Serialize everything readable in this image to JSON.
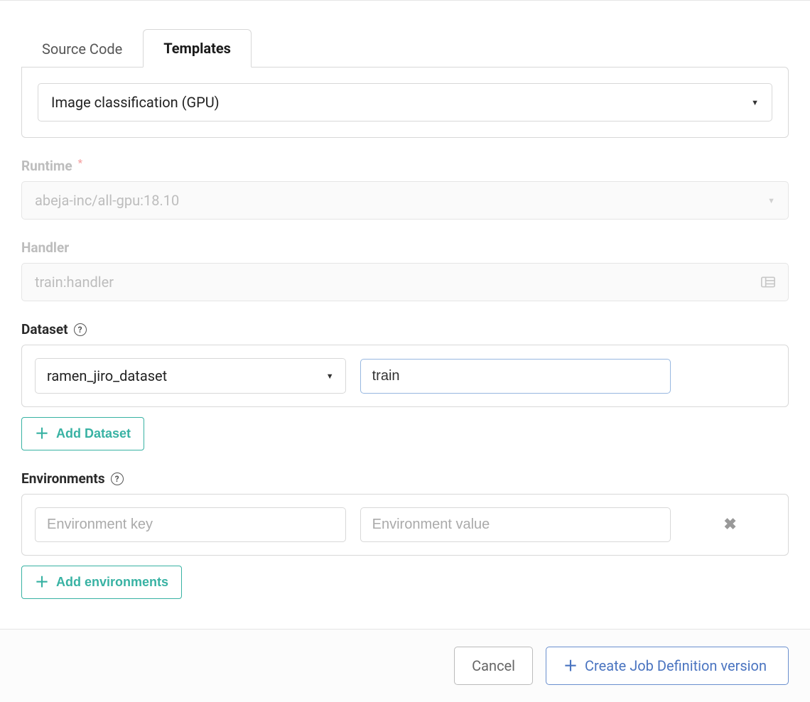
{
  "tabs": {
    "source_code": "Source Code",
    "templates": "Templates"
  },
  "template": {
    "selected": "Image classification (GPU)"
  },
  "runtime": {
    "label": "Runtime",
    "value": "abeja-inc/all-gpu:18.10"
  },
  "handler": {
    "label": "Handler",
    "value": "train:handler"
  },
  "dataset": {
    "label": "Dataset",
    "selected": "ramen_jiro_dataset",
    "name_value": "train",
    "add_label": "Add Dataset"
  },
  "environments": {
    "label": "Environments",
    "key_placeholder": "Environment key",
    "value_placeholder": "Environment value",
    "add_label": "Add environments"
  },
  "footer": {
    "cancel": "Cancel",
    "create": "Create Job Definition version"
  }
}
